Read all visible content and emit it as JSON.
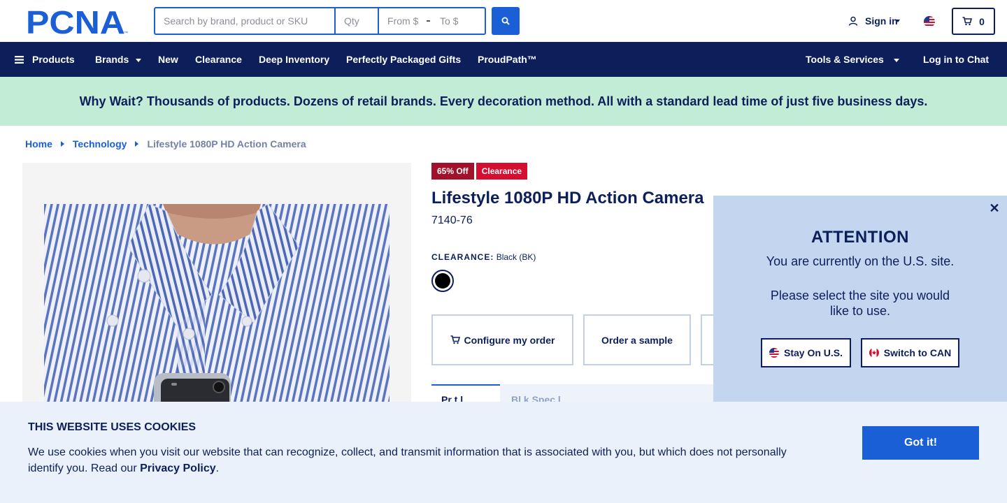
{
  "header": {
    "logo_text": "PCNA",
    "search": {
      "placeholder": "Search by brand, product or SKU",
      "value": ""
    },
    "qty": {
      "placeholder": "Qty"
    },
    "price_from": {
      "placeholder": "From $"
    },
    "price_to": {
      "placeholder": "To $"
    },
    "signin_label": "Sign in",
    "cart_count": "0",
    "icons": [
      "search-icon",
      "user-icon",
      "us-flag-icon",
      "cart-icon"
    ]
  },
  "nav": {
    "products": "Products",
    "brands": "Brands",
    "new": "New",
    "clearance": "Clearance",
    "deep_inventory": "Deep Inventory",
    "gifts": "Perfectly Packaged Gifts",
    "proudpath": "ProudPath™",
    "tools": "Tools & Services",
    "chat": "Log in to Chat"
  },
  "banner": {
    "text": "Why Wait? Thousands of products. Dozens of retail brands. Every decoration method. All with a standard lead time of just five business days."
  },
  "breadcrumb": {
    "home": "Home",
    "category": "Technology",
    "current": "Lifestyle 1080P HD Action Camera"
  },
  "product": {
    "badge_discount": "65% Off",
    "badge_clearance": "Clearance",
    "title": "Lifestyle 1080P HD Action Camera",
    "sku": "7140-76",
    "color_heading": "CLEARANCE:",
    "color_value": "Black (BK)",
    "swatch_color": "#000000",
    "actions": {
      "configure": "Configure my order",
      "sample": "Order a sample"
    },
    "tabs": {
      "first": "Pr   t  l",
      "second": "Bl   k   Spec  l"
    }
  },
  "region_modal": {
    "title": "ATTENTION",
    "line1": "You are currently on the U.S. site.",
    "line2": "Please select the site you would like to use.",
    "stay_label": "Stay On U.S.",
    "switch_label": "Switch to CAN"
  },
  "cookie": {
    "title": "THIS WEBSITE USES COOKIES",
    "text": "We use cookies when you visit our website that can recognize, collect, and transmit information that is associated with you, but which does not personally identify you. Read our",
    "link": "Privacy Policy",
    "period": ".",
    "button": "Got it!"
  },
  "colors": {
    "navy": "#0c1f5b",
    "accent_blue": "#1a5fd6",
    "banner_green": "#c3ecd7",
    "badge_red": "#d50f2f",
    "modal_bg": "#c4d5ef",
    "cookie_bg": "#eaf1fb"
  }
}
